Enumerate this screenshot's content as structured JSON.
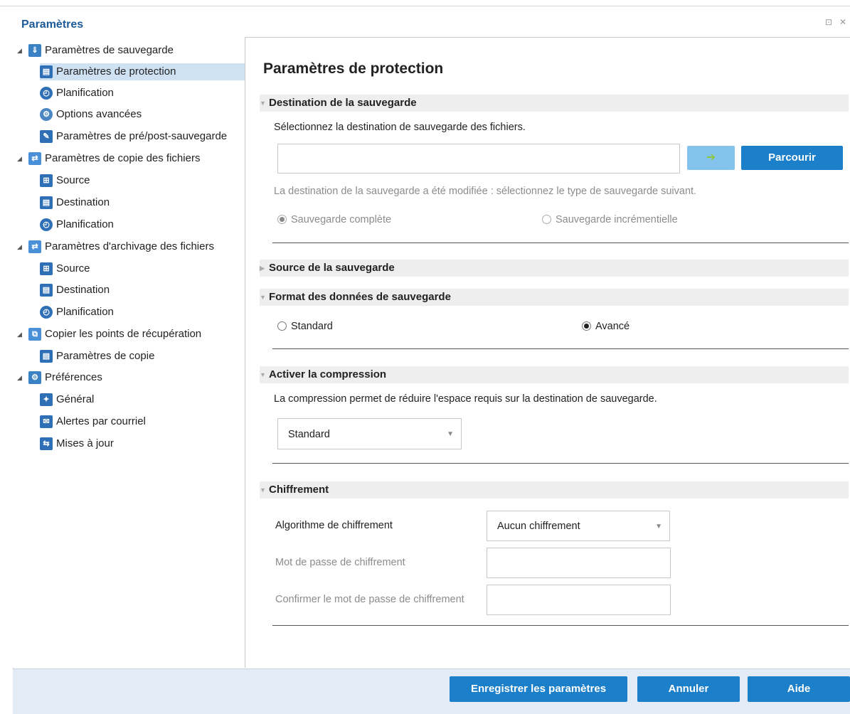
{
  "window": {
    "title": "Paramètres",
    "restore_glyph": "⊡",
    "close_glyph": "✕"
  },
  "sidebar": {
    "items": [
      {
        "label": "Paramètres de sauvegarde",
        "icon": "backup-icon"
      },
      {
        "label": "Paramètres de protection",
        "icon": "protection-icon"
      },
      {
        "label": "Planification",
        "icon": "schedule-icon"
      },
      {
        "label": "Options avancées",
        "icon": "advanced-options-icon"
      },
      {
        "label": "Paramètres de pré/post-sauvegarde",
        "icon": "wrench-icon"
      },
      {
        "label": "Paramètres de copie des fichiers",
        "icon": "file-copy-icon"
      },
      {
        "label": "Source",
        "icon": "source-icon"
      },
      {
        "label": "Destination",
        "icon": "destination-icon"
      },
      {
        "label": "Planification",
        "icon": "schedule-icon"
      },
      {
        "label": "Paramètres d'archivage des fichiers",
        "icon": "file-archive-icon"
      },
      {
        "label": "Source",
        "icon": "source-icon"
      },
      {
        "label": "Destination",
        "icon": "destination-icon"
      },
      {
        "label": "Planification",
        "icon": "schedule-icon"
      },
      {
        "label": "Copier les points de récupération",
        "icon": "copy-recovery-icon"
      },
      {
        "label": "Paramètres de copie",
        "icon": "copy-settings-icon"
      },
      {
        "label": "Préférences",
        "icon": "preferences-icon"
      },
      {
        "label": "Général",
        "icon": "general-icon"
      },
      {
        "label": "Alertes par courriel",
        "icon": "email-alert-icon"
      },
      {
        "label": "Mises à jour",
        "icon": "updates-icon"
      }
    ]
  },
  "main": {
    "title": "Paramètres de protection",
    "destination": {
      "header": "Destination de la sauvegarde",
      "description": "Sélectionnez la destination de sauvegarde des fichiers.",
      "path_value": "",
      "browse_label": "Parcourir",
      "go_glyph": "➔",
      "changed_notice": "La destination de la sauvegarde a été modifiée : sélectionnez le type de sauvegarde suivant.",
      "full_backup_label": "Sauvegarde complète",
      "incremental_backup_label": "Sauvegarde incrémentielle"
    },
    "source": {
      "header": "Source de la sauvegarde"
    },
    "format": {
      "header": "Format des données de sauvegarde",
      "standard_label": "Standard",
      "advanced_label": "Avancé"
    },
    "compression": {
      "header": "Activer la compression",
      "description": "La compression permet de réduire l'espace requis sur la destination de sauvegarde.",
      "selected": "Standard"
    },
    "encryption": {
      "header": "Chiffrement",
      "algorithm_label": "Algorithme de chiffrement",
      "algorithm_selected": "Aucun chiffrement",
      "password_label": "Mot de passe de chiffrement",
      "confirm_label": "Confirmer le mot de passe de chiffrement"
    }
  },
  "footer": {
    "save_label": "Enregistrer les paramètres",
    "cancel_label": "Annuler",
    "help_label": "Aide"
  },
  "colors": {
    "accent": "#1b7fc9",
    "selected_row": "#cfe2f3",
    "footer_bg": "#e2ebf6"
  }
}
